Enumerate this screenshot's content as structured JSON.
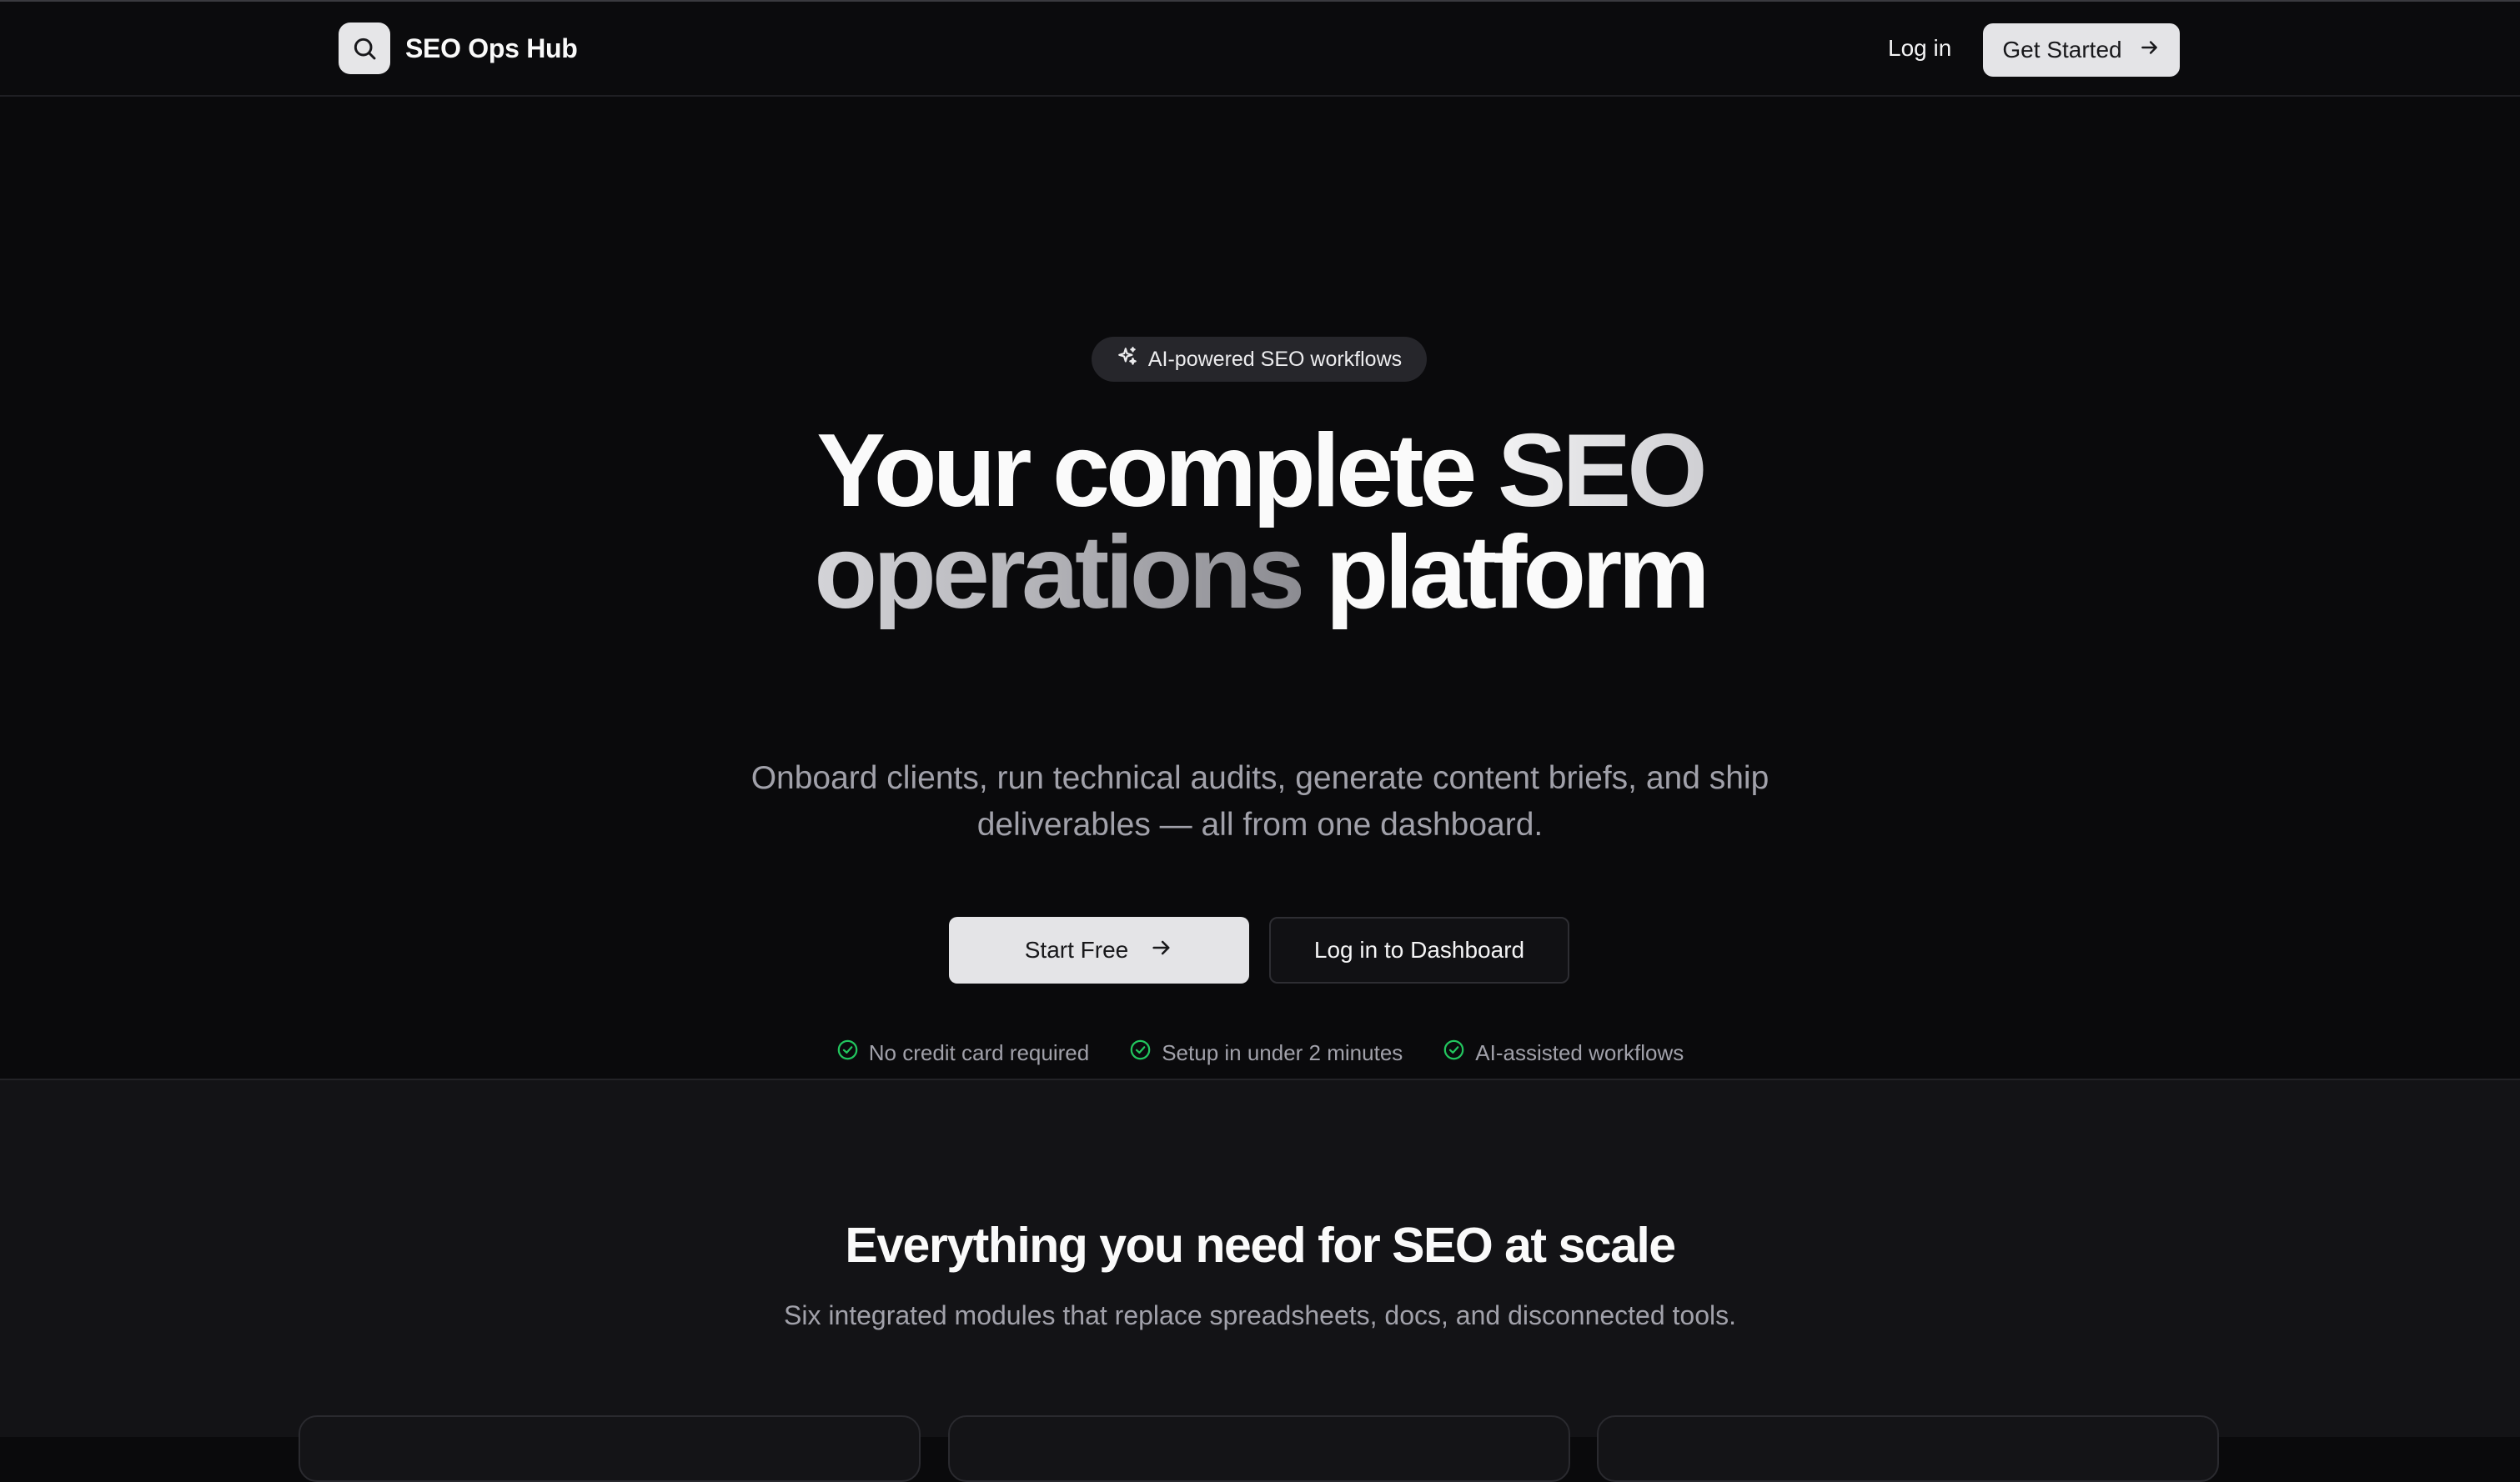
{
  "header": {
    "brand_name": "SEO Ops Hub",
    "brand_icon": "search-icon",
    "login_label": "Log in",
    "get_started_label": "Get Started"
  },
  "hero": {
    "badge_label": "AI-powered SEO workflows",
    "badge_icon": "sparkles-icon",
    "headline": {
      "part1": "Your complete ",
      "part2": "SEO",
      "part3": "operations",
      "part4": " platform"
    },
    "subtitle_line1": "Onboard clients, run technical audits, generate content briefs, and ship",
    "subtitle_line2": "deliverables — all from one dashboard.",
    "primary_cta": "Start Free",
    "secondary_cta": "Log in to Dashboard",
    "checks": [
      {
        "label": "No credit card required"
      },
      {
        "label": "Setup in under 2 minutes"
      },
      {
        "label": "AI-assisted workflows"
      }
    ]
  },
  "features": {
    "title": "Everything you need for SEO at scale",
    "subtitle": "Six integrated modules that replace spreadsheets, docs, and disconnected tools."
  },
  "colors": {
    "background": "#0a0a0c",
    "section_background": "#131316",
    "primary_button": "#e4e4e7",
    "check_green": "#22c55e",
    "muted_text": "#a1a1aa"
  }
}
